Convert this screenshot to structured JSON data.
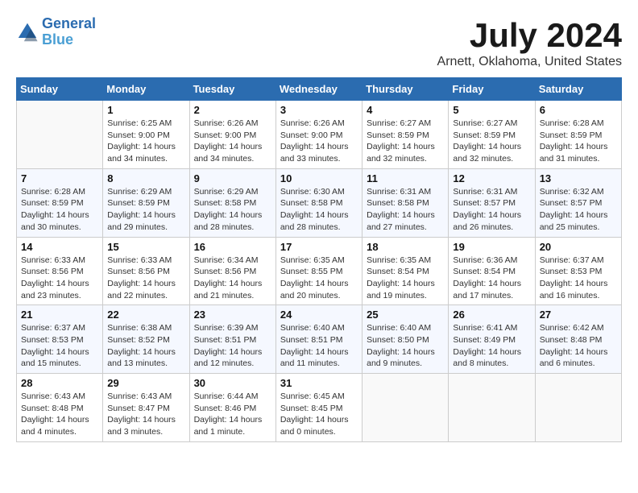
{
  "logo": {
    "line1": "General",
    "line2": "Blue"
  },
  "title": "July 2024",
  "subtitle": "Arnett, Oklahoma, United States",
  "days_of_week": [
    "Sunday",
    "Monday",
    "Tuesday",
    "Wednesday",
    "Thursday",
    "Friday",
    "Saturday"
  ],
  "weeks": [
    [
      {
        "day": "",
        "info": ""
      },
      {
        "day": "1",
        "info": "Sunrise: 6:25 AM\nSunset: 9:00 PM\nDaylight: 14 hours\nand 34 minutes."
      },
      {
        "day": "2",
        "info": "Sunrise: 6:26 AM\nSunset: 9:00 PM\nDaylight: 14 hours\nand 34 minutes."
      },
      {
        "day": "3",
        "info": "Sunrise: 6:26 AM\nSunset: 9:00 PM\nDaylight: 14 hours\nand 33 minutes."
      },
      {
        "day": "4",
        "info": "Sunrise: 6:27 AM\nSunset: 8:59 PM\nDaylight: 14 hours\nand 32 minutes."
      },
      {
        "day": "5",
        "info": "Sunrise: 6:27 AM\nSunset: 8:59 PM\nDaylight: 14 hours\nand 32 minutes."
      },
      {
        "day": "6",
        "info": "Sunrise: 6:28 AM\nSunset: 8:59 PM\nDaylight: 14 hours\nand 31 minutes."
      }
    ],
    [
      {
        "day": "7",
        "info": "Sunrise: 6:28 AM\nSunset: 8:59 PM\nDaylight: 14 hours\nand 30 minutes."
      },
      {
        "day": "8",
        "info": "Sunrise: 6:29 AM\nSunset: 8:59 PM\nDaylight: 14 hours\nand 29 minutes."
      },
      {
        "day": "9",
        "info": "Sunrise: 6:29 AM\nSunset: 8:58 PM\nDaylight: 14 hours\nand 28 minutes."
      },
      {
        "day": "10",
        "info": "Sunrise: 6:30 AM\nSunset: 8:58 PM\nDaylight: 14 hours\nand 28 minutes."
      },
      {
        "day": "11",
        "info": "Sunrise: 6:31 AM\nSunset: 8:58 PM\nDaylight: 14 hours\nand 27 minutes."
      },
      {
        "day": "12",
        "info": "Sunrise: 6:31 AM\nSunset: 8:57 PM\nDaylight: 14 hours\nand 26 minutes."
      },
      {
        "day": "13",
        "info": "Sunrise: 6:32 AM\nSunset: 8:57 PM\nDaylight: 14 hours\nand 25 minutes."
      }
    ],
    [
      {
        "day": "14",
        "info": "Sunrise: 6:33 AM\nSunset: 8:56 PM\nDaylight: 14 hours\nand 23 minutes."
      },
      {
        "day": "15",
        "info": "Sunrise: 6:33 AM\nSunset: 8:56 PM\nDaylight: 14 hours\nand 22 minutes."
      },
      {
        "day": "16",
        "info": "Sunrise: 6:34 AM\nSunset: 8:56 PM\nDaylight: 14 hours\nand 21 minutes."
      },
      {
        "day": "17",
        "info": "Sunrise: 6:35 AM\nSunset: 8:55 PM\nDaylight: 14 hours\nand 20 minutes."
      },
      {
        "day": "18",
        "info": "Sunrise: 6:35 AM\nSunset: 8:54 PM\nDaylight: 14 hours\nand 19 minutes."
      },
      {
        "day": "19",
        "info": "Sunrise: 6:36 AM\nSunset: 8:54 PM\nDaylight: 14 hours\nand 17 minutes."
      },
      {
        "day": "20",
        "info": "Sunrise: 6:37 AM\nSunset: 8:53 PM\nDaylight: 14 hours\nand 16 minutes."
      }
    ],
    [
      {
        "day": "21",
        "info": "Sunrise: 6:37 AM\nSunset: 8:53 PM\nDaylight: 14 hours\nand 15 minutes."
      },
      {
        "day": "22",
        "info": "Sunrise: 6:38 AM\nSunset: 8:52 PM\nDaylight: 14 hours\nand 13 minutes."
      },
      {
        "day": "23",
        "info": "Sunrise: 6:39 AM\nSunset: 8:51 PM\nDaylight: 14 hours\nand 12 minutes."
      },
      {
        "day": "24",
        "info": "Sunrise: 6:40 AM\nSunset: 8:51 PM\nDaylight: 14 hours\nand 11 minutes."
      },
      {
        "day": "25",
        "info": "Sunrise: 6:40 AM\nSunset: 8:50 PM\nDaylight: 14 hours\nand 9 minutes."
      },
      {
        "day": "26",
        "info": "Sunrise: 6:41 AM\nSunset: 8:49 PM\nDaylight: 14 hours\nand 8 minutes."
      },
      {
        "day": "27",
        "info": "Sunrise: 6:42 AM\nSunset: 8:48 PM\nDaylight: 14 hours\nand 6 minutes."
      }
    ],
    [
      {
        "day": "28",
        "info": "Sunrise: 6:43 AM\nSunset: 8:48 PM\nDaylight: 14 hours\nand 4 minutes."
      },
      {
        "day": "29",
        "info": "Sunrise: 6:43 AM\nSunset: 8:47 PM\nDaylight: 14 hours\nand 3 minutes."
      },
      {
        "day": "30",
        "info": "Sunrise: 6:44 AM\nSunset: 8:46 PM\nDaylight: 14 hours\nand 1 minute."
      },
      {
        "day": "31",
        "info": "Sunrise: 6:45 AM\nSunset: 8:45 PM\nDaylight: 14 hours\nand 0 minutes."
      },
      {
        "day": "",
        "info": ""
      },
      {
        "day": "",
        "info": ""
      },
      {
        "day": "",
        "info": ""
      }
    ]
  ]
}
